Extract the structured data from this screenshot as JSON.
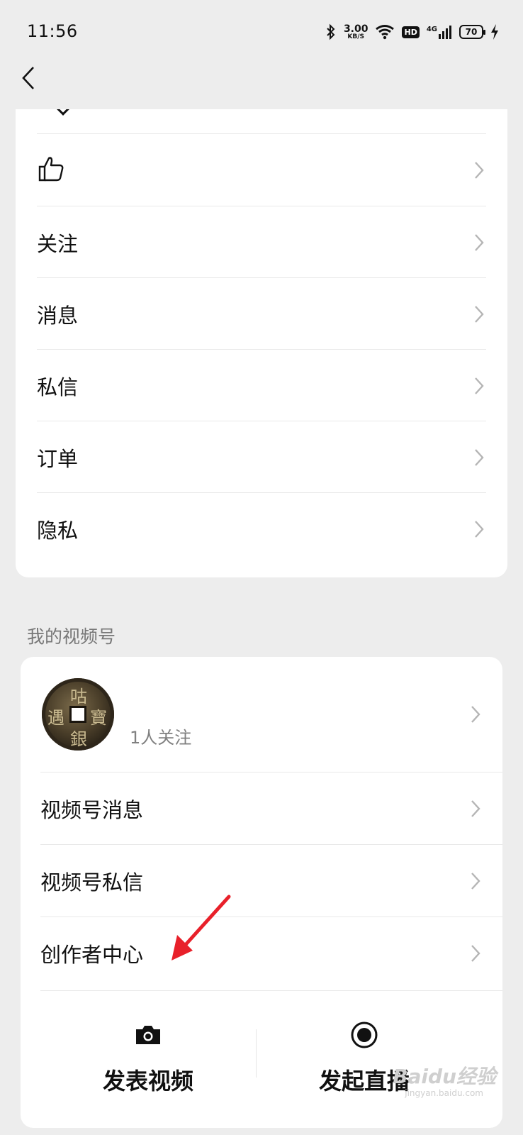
{
  "status": {
    "time": "11:56",
    "net_speed_value": "3.00",
    "net_speed_unit": "KB/S",
    "hd": "HD",
    "network": "4G",
    "battery": "70"
  },
  "top_menu": {
    "items": [
      {
        "label": "关注"
      },
      {
        "label": "消息"
      },
      {
        "label": "私信"
      },
      {
        "label": "订单"
      },
      {
        "label": "隐私"
      }
    ]
  },
  "channel_section": {
    "title": "我的视频号",
    "profile": {
      "followers": "1人关注",
      "avatar_glyphs": [
        "咕",
        "寶",
        "遇",
        "銀"
      ]
    },
    "items": [
      {
        "label": "视频号消息"
      },
      {
        "label": "视频号私信"
      },
      {
        "label": "创作者中心"
      }
    ],
    "actions": {
      "post_video": "发表视频",
      "start_live": "发起直播"
    }
  },
  "watermark": {
    "text": "Baidu经验",
    "sub": "jingyan.baidu.com"
  },
  "colors": {
    "background": "#ededed",
    "card": "#ffffff",
    "annotation_arrow": "#e8202a"
  },
  "icons": [
    "back-icon",
    "thumbs-up-icon",
    "chevron-right-icon",
    "camera-icon",
    "live-record-icon",
    "bluetooth-icon",
    "wifi-icon",
    "signal-icon",
    "battery-icon",
    "charging-icon"
  ]
}
